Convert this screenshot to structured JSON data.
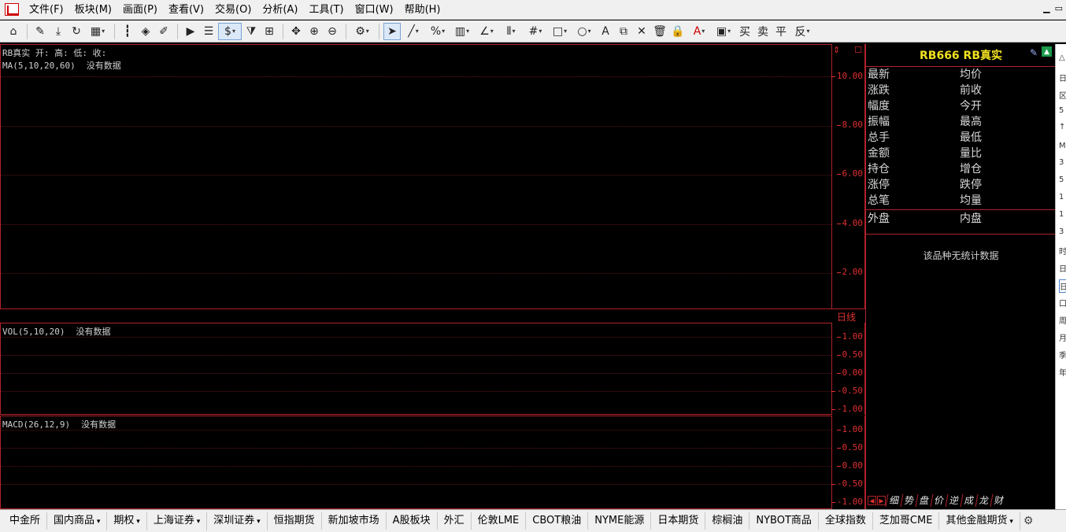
{
  "menu": [
    "文件(F)",
    "板块(M)",
    "画面(P)",
    "查看(V)",
    "交易(O)",
    "分析(A)",
    "工具(T)",
    "窗口(W)",
    "帮助(H)"
  ],
  "window_controls": [
    "▁",
    "▭"
  ],
  "chart": {
    "header_line": "RB真实 开: 高: 低: 收:",
    "ma_label": "MA(5,10,20,60)",
    "no_data": "没有数据",
    "main_ticks": [
      "10.00",
      "8.00",
      "6.00",
      "4.00",
      "2.00"
    ],
    "period_label": "日线",
    "vol_label": "VOL(5,10,20)",
    "vol_ticks": [
      "1.00",
      "0.50",
      "0.00",
      "-0.50",
      "-1.00"
    ],
    "macd_label": "MACD(26,12,9)",
    "macd_ticks": [
      "1.00",
      "0.50",
      "0.00",
      "-0.50",
      "-1.00"
    ],
    "axis_corner_symbols": [
      "⇕",
      "☐"
    ]
  },
  "info_panel": {
    "title": "RB666  RB真实",
    "rows_left": [
      "最新",
      "涨跌",
      "幅度",
      "振幅",
      "总手",
      "金额",
      "持仓",
      "涨停",
      "总笔"
    ],
    "rows_right": [
      "均价",
      "前收",
      "今开",
      "最高",
      "最低",
      "量比",
      "增仓",
      "跌停",
      "均量"
    ],
    "outer_label": "外盘",
    "inner_label": "内盘",
    "no_stat": "该品种无统计数据",
    "tabs": [
      "细",
      "势",
      "盘",
      "价",
      "逆",
      "成",
      "龙",
      "财"
    ]
  },
  "right_strip_glyphs": [
    "△",
    "日",
    "区",
    "5",
    "↑",
    "M",
    "3",
    "5",
    "1",
    "1",
    "3",
    "时",
    "日",
    "日",
    "口",
    "周",
    "月",
    "季",
    "年"
  ],
  "bottom_tabs": [
    {
      "label": "中金所",
      "dropdown": false
    },
    {
      "label": "国内商品",
      "dropdown": true
    },
    {
      "label": "期权",
      "dropdown": true
    },
    {
      "label": "上海证券",
      "dropdown": true
    },
    {
      "label": "深圳证券",
      "dropdown": true
    },
    {
      "label": "恒指期货",
      "dropdown": false
    },
    {
      "label": "新加坡市场",
      "dropdown": false
    },
    {
      "label": "A股板块",
      "dropdown": false
    },
    {
      "label": "外汇",
      "dropdown": false
    },
    {
      "label": "伦敦LME",
      "dropdown": false
    },
    {
      "label": "CBOT粮油",
      "dropdown": false
    },
    {
      "label": "NYME能源",
      "dropdown": false
    },
    {
      "label": "日本期货",
      "dropdown": false
    },
    {
      "label": "棕榈油",
      "dropdown": false
    },
    {
      "label": "NYBOT商品",
      "dropdown": false
    },
    {
      "label": "全球指数",
      "dropdown": false
    },
    {
      "label": "芝加哥CME",
      "dropdown": false
    },
    {
      "label": "其他金融期货",
      "dropdown": true
    }
  ],
  "toolbar_icons": [
    "home-icon",
    "ruler-icon",
    "download-icon",
    "refresh-icon",
    "grid-icon",
    "candlestick-icon",
    "diamond-icon",
    "edit-icon",
    "play-icon",
    "list-icon",
    "dollar-icon",
    "filter-icon",
    "chart-compare-icon",
    "move-icon",
    "zoom-in-icon",
    "zoom-out-icon",
    "settings-icon",
    "cursor-icon",
    "line-icon",
    "percent-icon",
    "ruler-bar-icon",
    "angle-icon",
    "vline-icon",
    "hash-icon",
    "rect-icon",
    "circle-icon",
    "text-icon",
    "copy-icon",
    "delete-icon",
    "trash-icon",
    "lock-icon",
    "color-icon",
    "save-icon",
    "buy-icon",
    "sell-icon",
    "flat-icon",
    "reverse-icon"
  ],
  "colors": {
    "axis_red": "#e03030",
    "title_yellow": "#f0e020",
    "border_red": "#b0232a"
  }
}
